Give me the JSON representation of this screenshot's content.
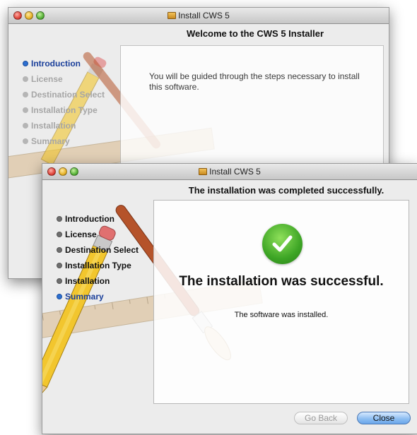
{
  "window_back": {
    "title": "Install CWS 5",
    "heading": "Welcome to the CWS 5 Installer",
    "steps": [
      {
        "label": "Introduction",
        "state": "current"
      },
      {
        "label": "License",
        "state": "pending"
      },
      {
        "label": "Destination Select",
        "state": "pending"
      },
      {
        "label": "Installation Type",
        "state": "pending"
      },
      {
        "label": "Installation",
        "state": "pending"
      },
      {
        "label": "Summary",
        "state": "pending"
      }
    ],
    "body_text": "You will be guided through the steps necessary to install this software."
  },
  "window_front": {
    "title": "Install CWS 5",
    "heading": "The installation was completed successfully.",
    "steps": [
      {
        "label": "Introduction",
        "state": "done"
      },
      {
        "label": "License",
        "state": "done"
      },
      {
        "label": "Destination Select",
        "state": "done"
      },
      {
        "label": "Installation Type",
        "state": "done"
      },
      {
        "label": "Installation",
        "state": "done"
      },
      {
        "label": "Summary",
        "state": "current"
      }
    ],
    "result_title": "The installation was successful.",
    "result_subtitle": "The software was installed.",
    "buttons": {
      "back": "Go Back",
      "close": "Close"
    }
  },
  "colors": {
    "accent": "#2d6fd0",
    "success": "#3da525"
  },
  "icons": [
    "package-icon",
    "step-bullet-icon",
    "checkmark-icon",
    "pencil-brush-ruler-artwork"
  ]
}
